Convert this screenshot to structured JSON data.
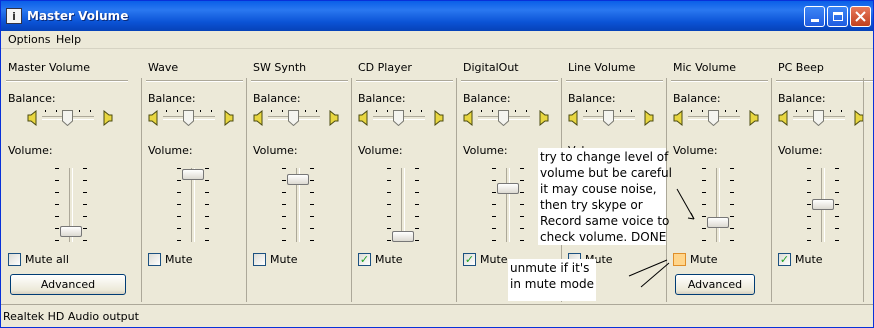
{
  "window": {
    "title": "Master Volume",
    "app_icon": "info-icon",
    "app_glyph": "i",
    "controls": {
      "minimize": "minimize-icon",
      "maximize": "maximize-icon",
      "close": "close-icon"
    }
  },
  "menu": {
    "options": "Options",
    "help": "Help"
  },
  "labels": {
    "balance": "Balance:",
    "volume": "Volume:",
    "mute": "Mute",
    "mute_all": "Mute all",
    "advanced": "Advanced"
  },
  "channels": [
    {
      "name": "Master Volume",
      "balance": 0.5,
      "volume": 0.12,
      "muted": false,
      "mute_label": "Mute all",
      "has_advanced": true
    },
    {
      "name": "Wave",
      "balance": 0.5,
      "volume": 0.92,
      "muted": false,
      "mute_label": "Mute",
      "has_advanced": false
    },
    {
      "name": "SW Synth",
      "balance": 0.5,
      "volume": 0.85,
      "muted": false,
      "mute_label": "Mute",
      "has_advanced": false
    },
    {
      "name": "CD Player",
      "balance": 0.5,
      "volume": 0.06,
      "muted": true,
      "mute_label": "Mute",
      "has_advanced": false
    },
    {
      "name": "DigitalOut",
      "balance": 0.5,
      "volume": 0.72,
      "muted": true,
      "mute_label": "Mute",
      "has_advanced": false
    },
    {
      "name": "Line Volume",
      "balance": 0.5,
      "volume": 0.5,
      "muted": false,
      "mute_label": "Mute",
      "has_advanced": false
    },
    {
      "name": "Mic Volume",
      "balance": 0.5,
      "volume": 0.25,
      "muted": false,
      "mute_label": "Mute",
      "has_advanced": true
    },
    {
      "name": "PC Beep",
      "balance": 0.5,
      "volume": 0.5,
      "muted": true,
      "mute_label": "Mute",
      "has_advanced": false
    }
  ],
  "annotations": {
    "note_volume": [
      "try to change level of",
      "volume but be careful",
      "it may couse noise,",
      "then try skype or",
      "Record same voice to",
      "check volume. DONE"
    ],
    "note_mute": [
      "unmute if it's",
      "in mute mode"
    ]
  },
  "status": {
    "text": "Realtek HD Audio output"
  },
  "colors": {
    "titlebar": "#0b53d6",
    "face": "#ece9d8",
    "check": "#21a121",
    "mute_highlight": "#ffd58b"
  }
}
